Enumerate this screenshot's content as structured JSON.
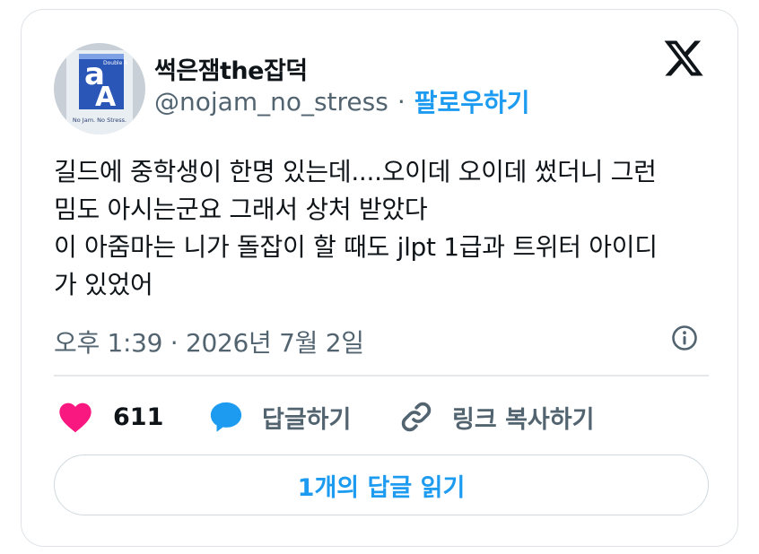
{
  "user": {
    "display_name": "썩은잼the잡덕",
    "handle": "@nojam_no_stress",
    "separator": "·",
    "follow_label": "팔로우하기",
    "avatar": {
      "icon": "double-a-paper-logo",
      "caption": "No Jam. No Stress."
    }
  },
  "brand": {
    "icon": "x-logo",
    "color": "#0f1419"
  },
  "tweet": {
    "lines": [
      "길드에 중학생이 한명 있는데....오이데 오이데 썼더니 그런",
      "밈도 아시는군요 그래서 상처 받았다",
      "이 아줌마는 니가 돌잡이 할 때도 jlpt 1급과 트위터 아이디",
      "가 있었어"
    ],
    "timestamp": "오후 1:39 · 2026년 7월 2일"
  },
  "actions": {
    "like_count": "611",
    "reply_label": "답글하기",
    "copy_link_label": "링크 복사하기"
  },
  "footer": {
    "read_replies_label": "1개의 답글 읽기"
  },
  "colors": {
    "accent": "#1d9bf0",
    "like": "#f91880",
    "text": "#0f1419",
    "secondary": "#536471",
    "border": "#dfe3e7"
  }
}
